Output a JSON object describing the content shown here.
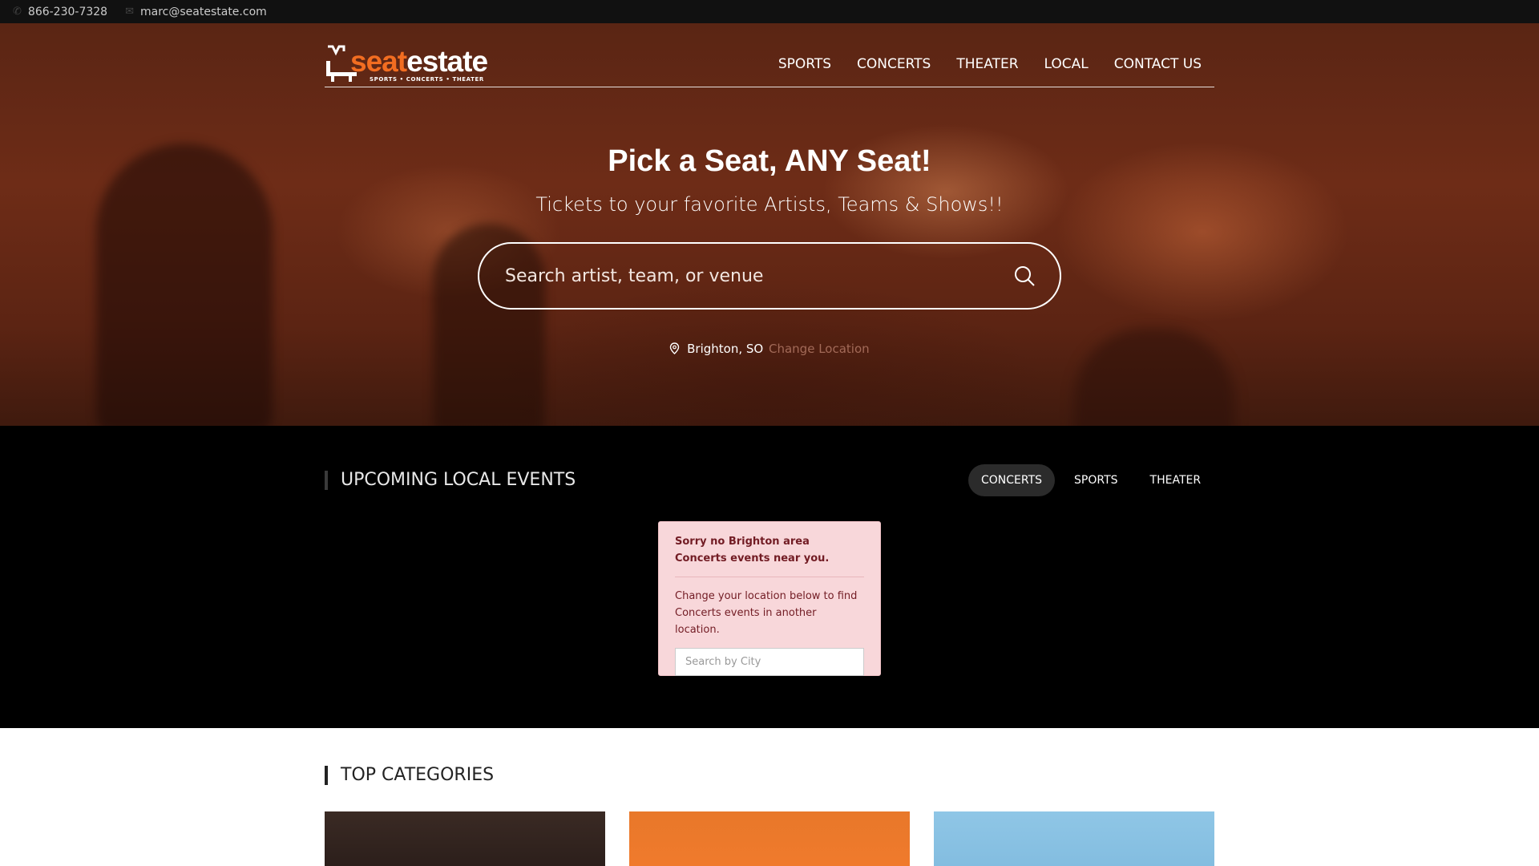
{
  "topbar": {
    "phone": "866-230-7328",
    "email": "marc@seatestate.com"
  },
  "logo": {
    "seat": "seat",
    "estate": "estate",
    "tagline": "SPORTS • CONCERTS • THEATER"
  },
  "nav": {
    "items": [
      "SPORTS",
      "CONCERTS",
      "THEATER",
      "LOCAL",
      "CONTACT US"
    ]
  },
  "hero": {
    "title": "Pick a Seat, ANY Seat!",
    "subtitle": "Tickets to your favorite Artists, Teams & Shows!!",
    "search_placeholder": "Search artist, team, or venue",
    "location": "Brighton, SO",
    "change_location": "Change Location"
  },
  "events": {
    "title": "UPCOMING LOCAL EVENTS",
    "tabs": [
      "CONCERTS",
      "SPORTS",
      "THEATER"
    ],
    "active_tab": "CONCERTS",
    "notice": {
      "heading": "Sorry no Brighton area Concerts events near you.",
      "body": "Change your location below to find Concerts events in another location.",
      "city_placeholder": "Search by City"
    }
  },
  "categories": {
    "title": "TOP CATEGORIES"
  },
  "colors": {
    "accent": "#f26d21",
    "alert_bg": "#f8d7da",
    "alert_text": "#721c24"
  }
}
